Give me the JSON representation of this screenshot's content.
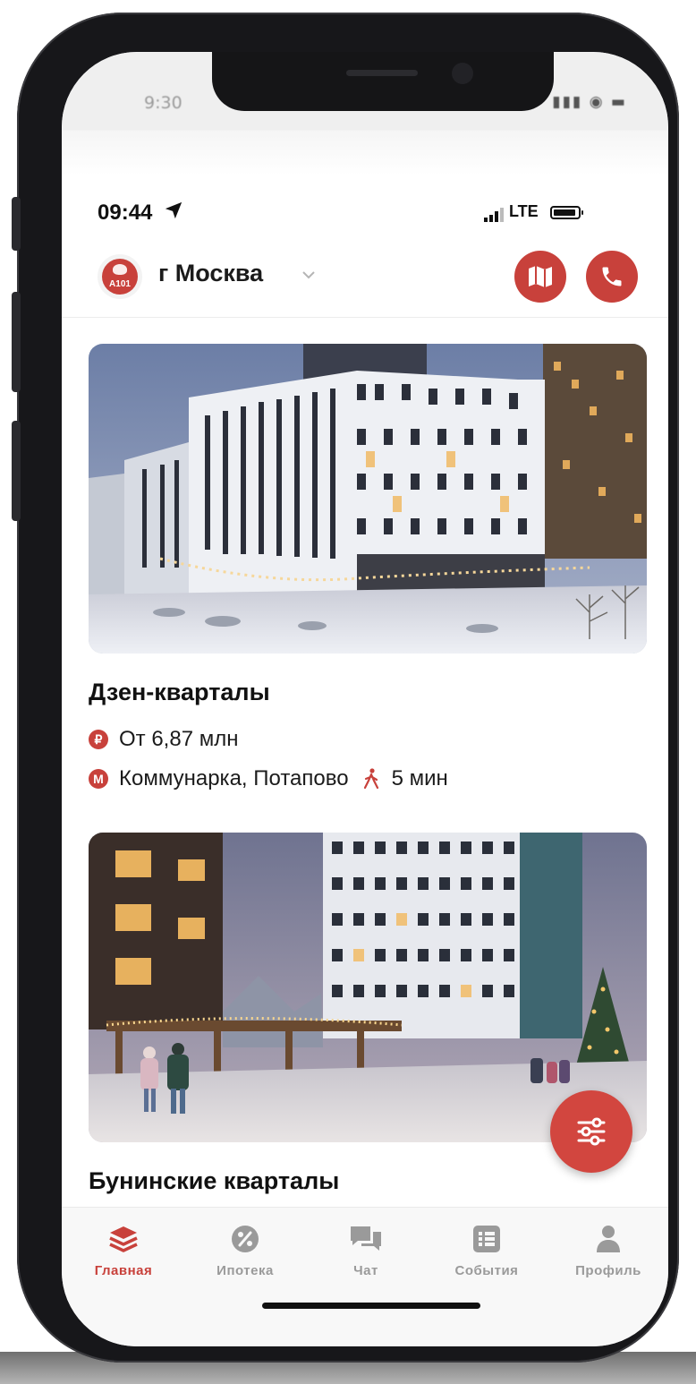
{
  "outer_status": {
    "time": "9:30"
  },
  "status_bar": {
    "time": "09:44",
    "network": "LTE"
  },
  "header": {
    "city": "г Москва"
  },
  "cards": [
    {
      "title": "Дзен-кварталы",
      "price": "От 6,87 млн",
      "metro": "Коммунарка, Потапово",
      "walk": "5 мин"
    },
    {
      "title": "Бунинские кварталы"
    }
  ],
  "tabs": [
    {
      "label": "Главная",
      "icon": "layers-icon",
      "active": true
    },
    {
      "label": "Ипотека",
      "icon": "percent-icon"
    },
    {
      "label": "Чат",
      "icon": "chat-icon"
    },
    {
      "label": "События",
      "icon": "events-icon"
    },
    {
      "label": "Профиль",
      "icon": "profile-icon"
    }
  ],
  "colors": {
    "accent": "#c8413b",
    "tab_inactive": "#9a9a9a",
    "text": "#111111"
  }
}
